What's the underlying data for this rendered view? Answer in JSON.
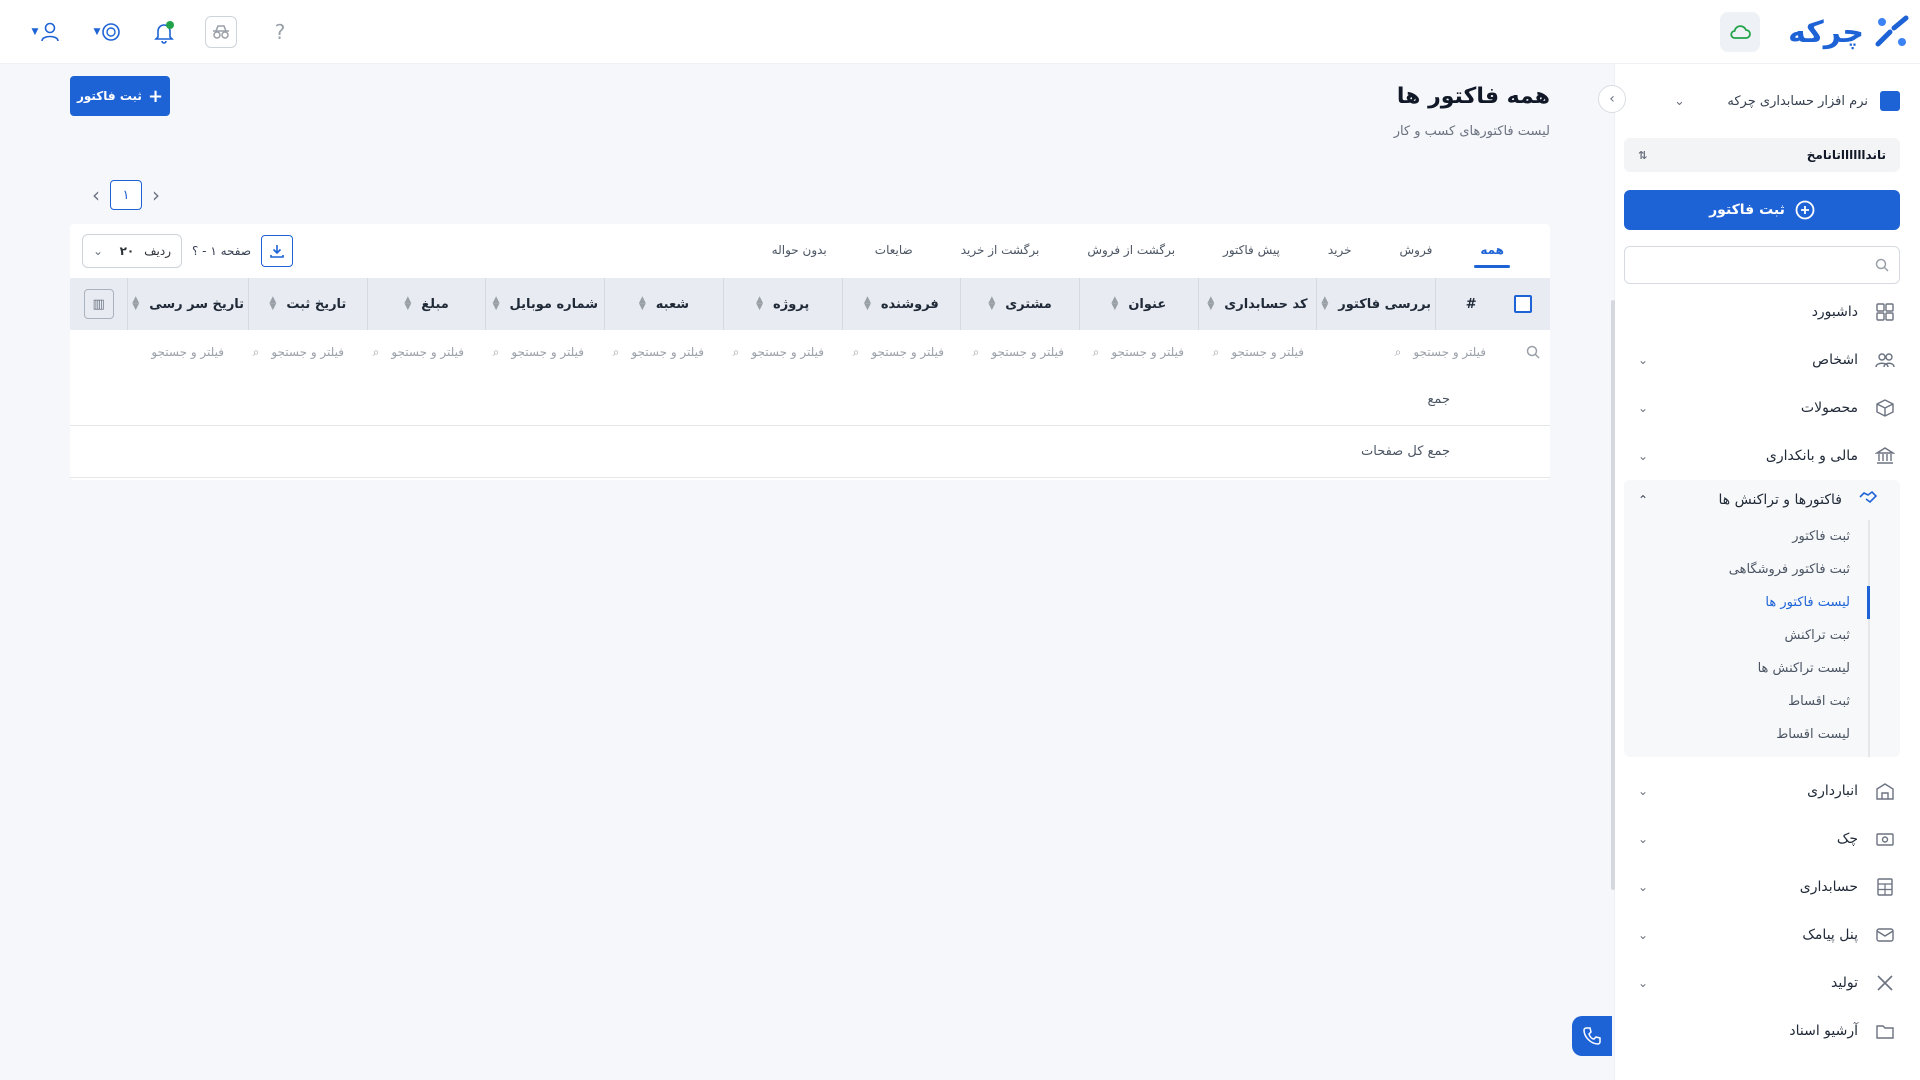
{
  "brand": {
    "name": "چرکه",
    "color": "#1e63d6"
  },
  "topbar": {
    "help_label": "?"
  },
  "sidebar": {
    "org_name": "نرم افزار حسابداری چرکه",
    "branch_name": "تاندااااااتانامخ",
    "new_invoice_label": "ثبت فاکتور",
    "search_placeholder": "",
    "menu": [
      {
        "label": "داشبورد",
        "icon": "dashboard-icon",
        "expandable": false
      },
      {
        "label": "اشخاص",
        "icon": "people-icon",
        "expandable": true
      },
      {
        "label": "محصولات",
        "icon": "box-icon",
        "expandable": true
      },
      {
        "label": "مالی و بانکداری",
        "icon": "bank-icon",
        "expandable": true
      }
    ],
    "open_menu": {
      "label": "فاکتورها و تراکنش ها",
      "icon": "handshake-icon",
      "items": [
        "ثبت فاکتور",
        "ثبت فاکتور فروشگاهی",
        "لیست فاکتور ها",
        "ثبت تراکنش",
        "لیست تراکنش ها",
        "ثبت اقساط",
        "لیست اقساط"
      ],
      "active_index": 2
    },
    "menu_after": [
      {
        "label": "انبارداری",
        "icon": "warehouse-icon"
      },
      {
        "label": "چک",
        "icon": "cheque-icon"
      },
      {
        "label": "حسابداری",
        "icon": "calculator-icon"
      },
      {
        "label": "پنل پیامک",
        "icon": "sms-icon"
      },
      {
        "label": "تولید",
        "icon": "tools-icon"
      },
      {
        "label": "آرشیو اسناد",
        "icon": "archive-icon"
      }
    ]
  },
  "main": {
    "title": "همه فاکتور ها",
    "subtitle": "لیست فاکتورهای کسب و کار",
    "add_button_label": "ثبت فاکتور",
    "pager": {
      "current": "۱"
    },
    "tabs": [
      "همه",
      "فروش",
      "خرید",
      "پیش فاکتور",
      "برگشت از فروش",
      "برگشت از خرید",
      "ضایعات",
      "بدون حواله"
    ],
    "active_tab": 0,
    "rows_label": "ردیف",
    "rows_value": "۲۰",
    "page_info": "صفحه ۱ - ؟",
    "columns": [
      "#",
      "بررسی فاکتور",
      "کد حسابداری",
      "عنوان",
      "مشتری",
      "فروشنده",
      "پروژه",
      "شعبه",
      "شماره موبایل",
      "مبلغ",
      "تاریخ ثبت",
      "تاریخ سر رسی"
    ],
    "filter_placeholder": "فیلتر و جستجو",
    "sum_label": "جمع",
    "sum_all_label": "جمع کل صفحات"
  }
}
